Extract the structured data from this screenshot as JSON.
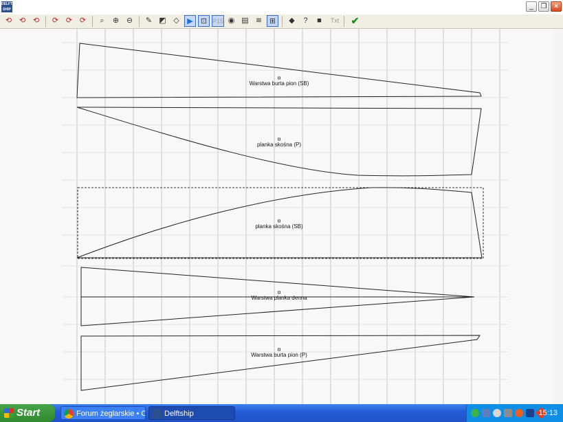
{
  "window": {
    "title": "",
    "logo_text": "DELFT SHIP"
  },
  "toolbar": {
    "buttons": [
      {
        "name": "rotate-1-icon",
        "glyph": "⟲"
      },
      {
        "name": "rotate-2-icon",
        "glyph": "⟲"
      },
      {
        "name": "rotate-3-icon",
        "glyph": "⟲"
      },
      {
        "name": "rotate-4-icon",
        "glyph": "⟳"
      },
      {
        "name": "rotate-5-icon",
        "glyph": "⟳"
      },
      {
        "name": "rotate-6-icon",
        "glyph": "⟳"
      },
      {
        "name": "zoom-extents-icon",
        "glyph": "⌕"
      },
      {
        "name": "zoom-in-icon",
        "glyph": "⊕"
      },
      {
        "name": "zoom-out-icon",
        "glyph": "⊖"
      },
      {
        "name": "pencil-icon",
        "glyph": "✎"
      },
      {
        "name": "flip-icon",
        "glyph": "◩"
      },
      {
        "name": "eraser-icon",
        "glyph": "◇"
      },
      {
        "name": "arrow-icon",
        "glyph": "▶"
      },
      {
        "name": "dimension-icon",
        "glyph": "⊡"
      },
      {
        "name": "panel-label-icon",
        "glyph": "P15"
      },
      {
        "name": "mirror-icon",
        "glyph": "◉"
      },
      {
        "name": "ruler-icon",
        "glyph": "▤"
      },
      {
        "name": "layers-icon",
        "glyph": "≋"
      },
      {
        "name": "grid-icon",
        "glyph": "⊞"
      },
      {
        "name": "shape-icon",
        "glyph": "◆"
      },
      {
        "name": "help-icon",
        "glyph": "?"
      },
      {
        "name": "box-icon",
        "glyph": "■"
      },
      {
        "name": "text-icon",
        "glyph": "Txt"
      },
      {
        "name": "ok-check-icon",
        "glyph": "✔"
      }
    ]
  },
  "canvas": {
    "panels": [
      {
        "label": "Warstwa burta pion (SB)"
      },
      {
        "label": "planka skośna (P)"
      },
      {
        "label": "planka skośna (SB)"
      },
      {
        "label": "Warstwa planka denna"
      },
      {
        "label": "Warstwa burta pion (P)"
      }
    ]
  },
  "taskbar": {
    "start_label": "Start",
    "tasks": [
      {
        "label": "Forum żeglarskie • O...",
        "active": false
      },
      {
        "label": "Delftship",
        "active": true
      }
    ],
    "clock": "15:13"
  },
  "colors": {
    "accent": "#245dd7",
    "tray": "#0f8ee6",
    "ok": "#1a8a1a"
  }
}
